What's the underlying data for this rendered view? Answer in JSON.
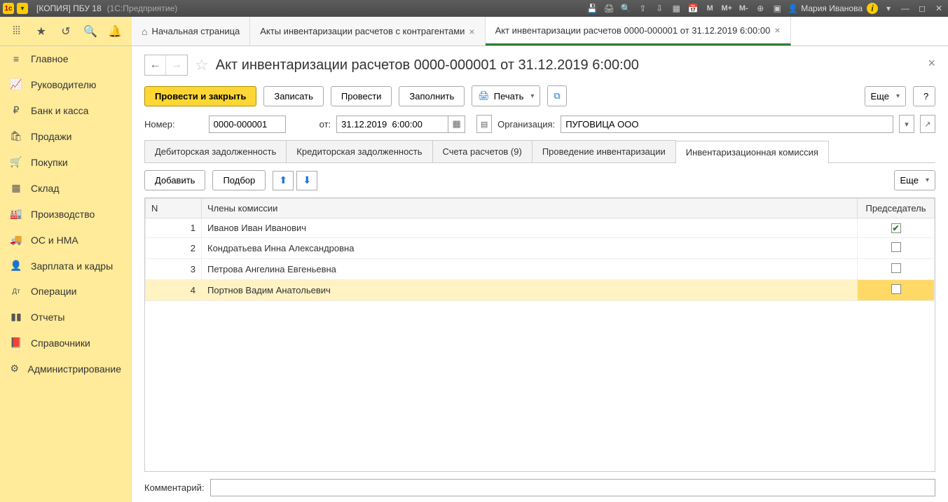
{
  "titlebar": {
    "title": "[КОПИЯ] ПБУ 18",
    "subtitle": "(1С:Предприятие)",
    "user": "Мария Иванова",
    "m": "M",
    "mplus": "M+",
    "mminus": "M-"
  },
  "apptabs": {
    "home": "Начальная страница",
    "tab1": "Акты инвентаризации расчетов с контрагентами",
    "tab2": "Акт инвентаризации расчетов 0000-000001 от 31.12.2019 6:00:00"
  },
  "sidebar": {
    "items": [
      {
        "icon": "≡",
        "label": "Главное"
      },
      {
        "icon": "📈",
        "label": "Руководителю"
      },
      {
        "icon": "₽",
        "label": "Банк и касса"
      },
      {
        "icon": "🛍",
        "label": "Продажи"
      },
      {
        "icon": "🛒",
        "label": "Покупки"
      },
      {
        "icon": "▦",
        "label": "Склад"
      },
      {
        "icon": "🏭",
        "label": "Производство"
      },
      {
        "icon": "🚚",
        "label": "ОС и НМА"
      },
      {
        "icon": "👤",
        "label": "Зарплата и кадры"
      },
      {
        "icon": "Дт",
        "label": "Операции"
      },
      {
        "icon": "▮▮",
        "label": "Отчеты"
      },
      {
        "icon": "📕",
        "label": "Справочники"
      },
      {
        "icon": "⚙",
        "label": "Администрирование"
      }
    ]
  },
  "doc": {
    "title": "Акт инвентаризации расчетов 0000-000001 от 31.12.2019 6:00:00",
    "actions": {
      "post_close": "Провести и закрыть",
      "save": "Записать",
      "post": "Провести",
      "fill": "Заполнить",
      "print": "Печать",
      "more": "Еще",
      "help": "?"
    },
    "form": {
      "num_label": "Номер:",
      "num": "0000-000001",
      "from_label": "от:",
      "date": "31.12.2019  6:00:00",
      "org_label": "Организация:",
      "org": "ПУГОВИЦА ООО"
    },
    "subtabs": {
      "t1": "Дебиторская задолженность",
      "t2": "Кредиторская задолженность",
      "t3": "Счета расчетов (9)",
      "t4": "Проведение инвентаризации",
      "t5": "Инвентаризационная комиссия"
    },
    "tblbar": {
      "add": "Добавить",
      "pick": "Подбор",
      "more": "Еще"
    },
    "table": {
      "col_n": "N",
      "col_member": "Члены комиссии",
      "col_chair": "Председатель",
      "rows": [
        {
          "n": "1",
          "name": "Иванов Иван Иванович",
          "chair": true
        },
        {
          "n": "2",
          "name": "Кондратьева Инна Александровна",
          "chair": false
        },
        {
          "n": "3",
          "name": "Петрова Ангелина Евгеньевна",
          "chair": false
        },
        {
          "n": "4",
          "name": "Портнов Вадим Анатольевич",
          "chair": false
        }
      ]
    },
    "comment_label": "Комментарий:"
  }
}
